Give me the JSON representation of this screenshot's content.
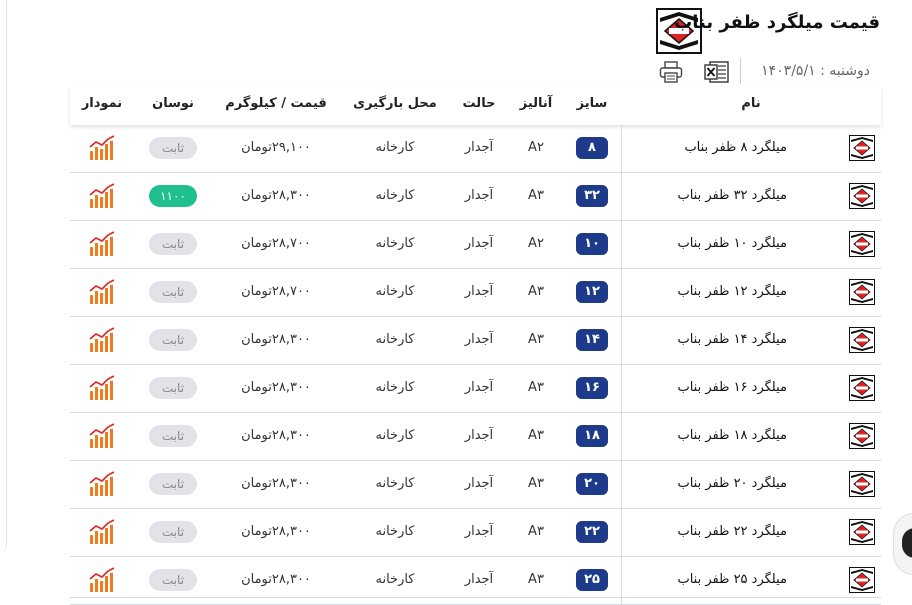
{
  "page": {
    "title": "قیمت میلگرد ظفر بناب",
    "date": "دوشنبه : ۱۴۰۳/۵/۱"
  },
  "icons": {
    "brand": "zafar-bonab-logo-icon",
    "excel": "excel-icon",
    "print": "printer-icon",
    "chart": "bar-chart-icon"
  },
  "colors": {
    "size_badge": "#1e3a8a",
    "change_up": "#1fc08e",
    "change_flat": "#e2e3e6",
    "logo_red": "#e02424"
  },
  "table": {
    "headers": {
      "name": "نام",
      "size": "سایز",
      "grade": "آنالیز",
      "state": "حالت",
      "location": "محل بارگیری",
      "price": "قیمت / کیلوگرم",
      "change": "نوسان",
      "chart": "نمودار"
    },
    "rows": [
      {
        "name": "میلگرد ۸ ظفر بناب",
        "size": "۸",
        "grade": "A۲",
        "state": "آجدار",
        "location": "کارخانه",
        "price": "۲۹,۱۰۰تومان",
        "change": "ثابت",
        "change_type": "flat"
      },
      {
        "name": "میلگرد ۳۲ ظفر بناب",
        "size": "۳۲",
        "grade": "A۳",
        "state": "آجدار",
        "location": "کارخانه",
        "price": "۲۸,۳۰۰تومان",
        "change": "۱۱۰۰",
        "change_type": "up"
      },
      {
        "name": "میلگرد ۱۰ ظفر بناب",
        "size": "۱۰",
        "grade": "A۲",
        "state": "آجدار",
        "location": "کارخانه",
        "price": "۲۸,۷۰۰تومان",
        "change": "ثابت",
        "change_type": "flat"
      },
      {
        "name": "میلگرد ۱۲ ظفر بناب",
        "size": "۱۲",
        "grade": "A۳",
        "state": "آجدار",
        "location": "کارخانه",
        "price": "۲۸,۷۰۰تومان",
        "change": "ثابت",
        "change_type": "flat"
      },
      {
        "name": "میلگرد ۱۴ ظفر بناب",
        "size": "۱۴",
        "grade": "A۳",
        "state": "آجدار",
        "location": "کارخانه",
        "price": "۲۸,۳۰۰تومان",
        "change": "ثابت",
        "change_type": "flat"
      },
      {
        "name": "میلگرد ۱۶ ظفر بناب",
        "size": "۱۶",
        "grade": "A۳",
        "state": "آجدار",
        "location": "کارخانه",
        "price": "۲۸,۳۰۰تومان",
        "change": "ثابت",
        "change_type": "flat"
      },
      {
        "name": "میلگرد ۱۸ ظفر بناب",
        "size": "۱۸",
        "grade": "A۳",
        "state": "آجدار",
        "location": "کارخانه",
        "price": "۲۸,۳۰۰تومان",
        "change": "ثابت",
        "change_type": "flat"
      },
      {
        "name": "میلگرد ۲۰ ظفر بناب",
        "size": "۲۰",
        "grade": "A۳",
        "state": "آجدار",
        "location": "کارخانه",
        "price": "۲۸,۳۰۰تومان",
        "change": "ثابت",
        "change_type": "flat"
      },
      {
        "name": "میلگرد ۲۲ ظفر بناب",
        "size": "۲۲",
        "grade": "A۳",
        "state": "آجدار",
        "location": "کارخانه",
        "price": "۲۸,۳۰۰تومان",
        "change": "ثابت",
        "change_type": "flat"
      },
      {
        "name": "میلگرد ۲۵ ظفر بناب",
        "size": "۲۵",
        "grade": "A۳",
        "state": "آجدار",
        "location": "کارخانه",
        "price": "۲۸,۳۰۰تومان",
        "change": "ثابت",
        "change_type": "flat"
      }
    ]
  }
}
